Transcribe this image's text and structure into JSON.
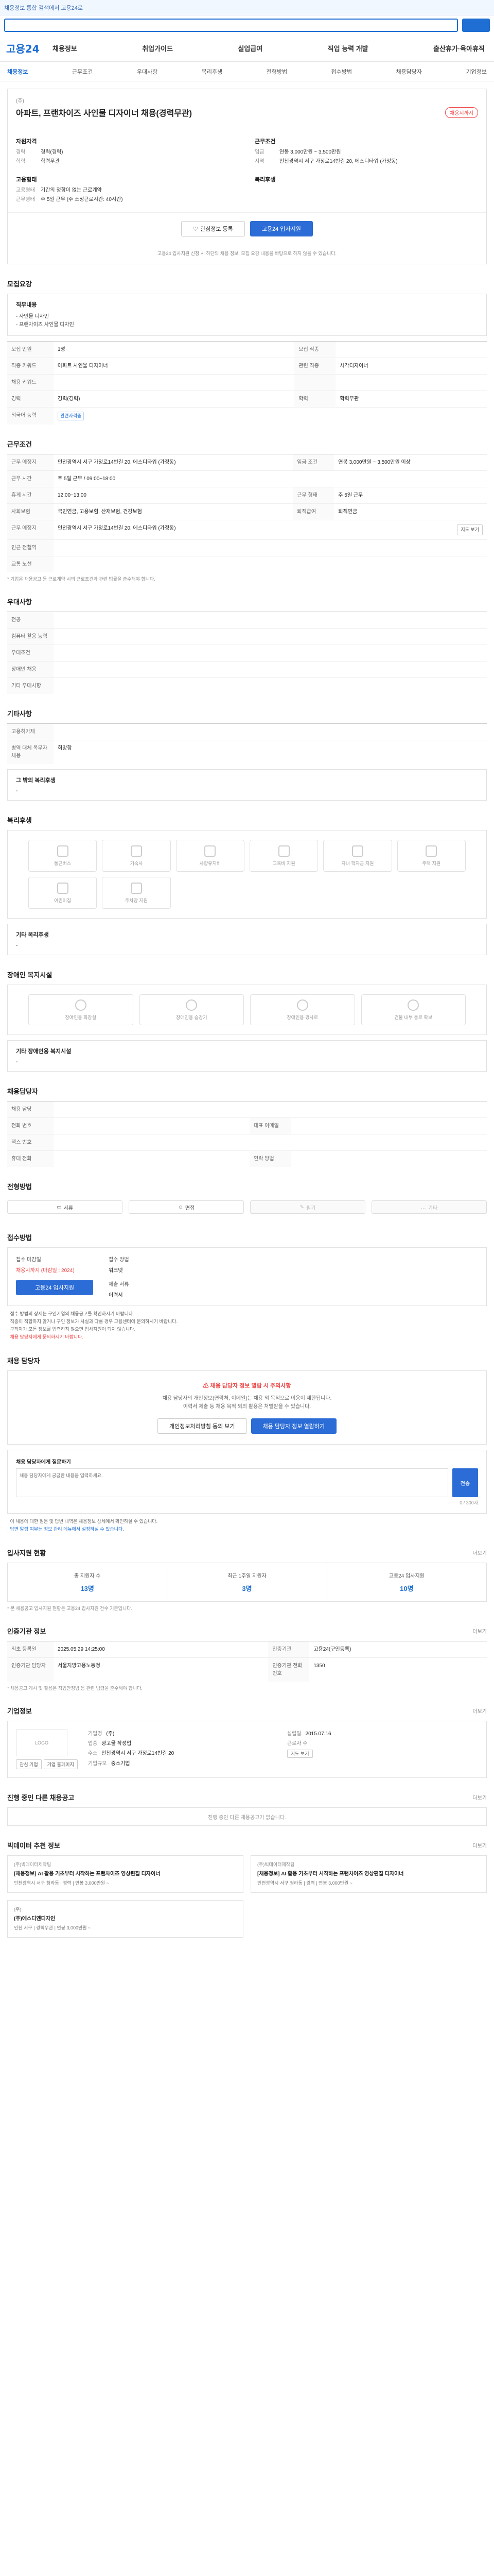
{
  "topbar": {
    "text": "채용정보 통합 검색에서 고용24로"
  },
  "gnb": {
    "logo": "고용24",
    "nav": [
      "채용정보",
      "취업가이드",
      "실업급여",
      "직업 능력 개발",
      "출산휴가·육아휴직"
    ]
  },
  "lnb": [
    "채용정보",
    "근무조건",
    "우대사항",
    "복리후생",
    "전형방법",
    "접수방법",
    "채용담당자",
    "기업정보"
  ],
  "job": {
    "company": "(주)",
    "title": "아파트, 프랜차이즈 사인물 디자이너 채용(경력무관)",
    "badge": "채용시까지",
    "left_head": "자원자격",
    "left_kv": [
      {
        "k": "경력",
        "v": "경력(경력)"
      },
      {
        "k": "학력",
        "v": "학력무관"
      }
    ],
    "right_head": "근무조건",
    "right_kv": [
      {
        "k": "임금",
        "v": "연봉 3,000만원 ~ 3,500만원"
      },
      {
        "k": "지역",
        "v": "인천광역시 서구 가정로14번길 20, 에스디타워 (가정동)"
      }
    ],
    "left2_head": "고용형태",
    "left2_kv": [
      {
        "k": "고용형태",
        "v": "기간의 정함이 없는 근로계약"
      },
      {
        "k": "근무형태",
        "v": "주 5일 근무 (주 소정근로시간: 40시간)"
      }
    ],
    "right2_head": "복리후생",
    "right2_kv": [],
    "btn_scrap": "관심정보 등록",
    "btn_apply": "고용24 입사지원",
    "note": "고용24 입사지원 신청 시 하단의 채용 정보, 모집 요강 내용을 바탕으로 하지 않을 수 있습니다."
  },
  "recruit": {
    "title": "모집요강",
    "work_label": "직무내용",
    "work_lines": [
      "- 사인물 디자인",
      "- 프랜차이즈 사인물 디자인"
    ],
    "rows": [
      {
        "k": "모집 인원",
        "v": "1명",
        "k2": "모집 직종",
        "v2": ""
      },
      {
        "k": "직종 키워드",
        "v": "아파트 사인물 디자이너",
        "k2": "관련 직종",
        "v2": "시각디자이너"
      },
      {
        "k": "채용 키워드",
        "v": "",
        "k2": "",
        "v2": ""
      },
      {
        "k": "경력",
        "v": "경력(경력)",
        "k2": "학력",
        "v2": "학력무관"
      },
      {
        "k": "외국어 능력",
        "v": "관련자격증",
        "k2": "",
        "v2": ""
      }
    ]
  },
  "conditions": {
    "title": "근무조건",
    "rows": [
      {
        "k": "근무 예정지",
        "v": "인천광역시 서구 가정로14번길 20, 에스디타워 (가정동)",
        "k2": "임금 조건",
        "v2": "연봉 3,000만원 ~ 3,500만원 이상"
      },
      {
        "k": "근무 시간",
        "v": "주 5일 근무 / 09:00~18:00",
        "k2": "",
        "v2": ""
      },
      {
        "k": "휴게 시간",
        "v": "12:00~13:00",
        "k2": "근무 형태",
        "v2": "주 5일 근무"
      },
      {
        "k": "사회보험",
        "v": "국민연금, 고용보험, 산재보험, 건강보험",
        "k2": "퇴직급여",
        "v2": "퇴직연금"
      },
      {
        "k": "근무 예정지",
        "v": "인천광역시 서구 가정로14번길 20, 에스디타워 (가정동)",
        "k2": "",
        "v2": ""
      },
      {
        "k": "인근 전철역",
        "v": "",
        "k2": "",
        "v2": ""
      },
      {
        "k": "교통 노선",
        "v": "",
        "k2": "",
        "v2": ""
      }
    ],
    "map_btn": "지도 보기",
    "note": "* 기업은 채용공고 등 근로계약 시의 근로조건과 관련 법률을 준수해야 합니다."
  },
  "prefer": {
    "title": "우대사항",
    "rows": [
      {
        "k": "전공",
        "v": ""
      },
      {
        "k": "컴퓨터 활용 능력",
        "v": ""
      },
      {
        "k": "우대조건",
        "v": ""
      },
      {
        "k": "장애인 채용",
        "v": ""
      },
      {
        "k": "기타 우대사항",
        "v": ""
      }
    ]
  },
  "etc": {
    "title": "기타사항",
    "rows": [
      {
        "k": "고용허가제",
        "v": ""
      },
      {
        "k": "병역 대체 복무자 채용",
        "v": "희망함"
      }
    ],
    "other_label": "그 밖의 복리후생",
    "other_value": "-"
  },
  "welfare": {
    "title": "복리후생",
    "items": [
      "통근버스",
      "기숙사",
      "차량유지비",
      "교육비 지원",
      "자녀 학자금 지원",
      "주택 지원",
      "어린이집",
      "주차장 지원",
      "",
      "",
      "",
      ""
    ],
    "other_label": "기타 복리후생",
    "other_value": "-"
  },
  "disabled": {
    "title": "장애인 복지시설",
    "items": [
      "장애인용 화장실",
      "장애인용 승강기",
      "장애인용 경사로",
      "건물 내부 통로 확보"
    ],
    "other_label": "기타 장애인용 복지시설",
    "other_value": "-"
  },
  "contact_info": {
    "title": "채용담당자",
    "rows": [
      {
        "k": "채용 담당",
        "v": "",
        "k2": "",
        "v2": ""
      },
      {
        "k": "전화 번호",
        "v": "",
        "k2": "대표 이메일",
        "v2": ""
      },
      {
        "k": "팩스 번호",
        "v": "",
        "k2": "",
        "v2": ""
      },
      {
        "k": "휴대 전화",
        "v": "",
        "k2": "연락 방법",
        "v2": ""
      }
    ]
  },
  "selection": {
    "title": "전형방법",
    "methods": [
      "서류",
      "면접",
      "필기",
      "기타"
    ]
  },
  "apply": {
    "title": "접수방법",
    "deadline_label": "접수 마감일",
    "deadline_value": "채용시까지 (마감일 : 2024)",
    "apply_btn": "고용24 입사지원",
    "method_label": "접수 방법",
    "method_value": "워크넷",
    "docs_label": "제출 서류",
    "docs_value": "이력서",
    "bullets": [
      "· 접수 방법의 상세는 구인기업의 채용공고를 확인하시기 바랍니다.",
      "· 직종이 적합하지 않거나 구인 정보가 사실과 다를 경우 고용센터에 문의하시기 바랍니다.",
      "· 구직자가 모든 정보를 입력하지 않으면 입사지원이 되지 않습니다.",
      "· 채용 담당자에게 문의하시기 바랍니다."
    ]
  },
  "manager": {
    "title": "채용 담당자",
    "warn_head": "채용 담당자 정보 열람 시 주의사항",
    "warn_lines": [
      "채용 담당자의 개인정보(연락처, 이메일)는 채용 외 목적으로 이용이 제한됩니다.",
      "이력서 제출 등 채용 목적 외의 활용은 처벌받을 수 있습니다."
    ],
    "btn1": "개인정보처리방침 동의 보기",
    "btn2": "채용 담당자 정보 열람하기",
    "qna_label": "채용 담당자에게 질문하기",
    "qna_placeholder": "채용 담당자에게 궁금한 내용을 입력하세요.",
    "qna_count": "0 / 300자",
    "qna_btn": "전송",
    "qna_notes": [
      "· 이 채용에 대한 질문 및 답변 내역은 채용정보 상세에서 확인하실 수 있습니다.",
      "· 답변 알림 여부는 정보 관리 메뉴에서 설정하실 수 있습니다."
    ]
  },
  "stats": {
    "title": "입사지원 현황",
    "more": "더보기",
    "items": [
      {
        "label": "총 지원자 수",
        "value": "13명"
      },
      {
        "label": "최근 1주일 지원자",
        "value": "3명"
      },
      {
        "label": "고용24 입사지원",
        "value": "10명"
      }
    ],
    "note": "* 본 채용공고 입사지원 현황은 고용24 입사지원 건수 기준입니다."
  },
  "org": {
    "title": "인증기관 정보",
    "more": "더보기",
    "rows": [
      {
        "k": "최초 등록일",
        "v": "2025.05.29 14:25:00",
        "k2": "인증기관",
        "v2": "고용24(구인등록)"
      },
      {
        "k": "인증기관 담당자",
        "v": "서울지방고용노동청",
        "k2": "인증기관 전화번호",
        "v2": "1350"
      }
    ],
    "note": "* 채용공고 게시 및 활용은 직업안정법 등 관련 법령을 준수해야 합니다."
  },
  "company": {
    "title": "기업정보",
    "more": "더보기",
    "logo": "LOGO",
    "btn1": "관심 기업",
    "btn2": "기업 홈페이지",
    "info": [
      {
        "k": "기업명",
        "v": "(주)"
      },
      {
        "k": "설립일",
        "v": "2015.07.16"
      },
      {
        "k": "업종",
        "v": "광고물 작성업"
      },
      {
        "k": "근로자 수",
        "v": ""
      },
      {
        "k": "주소",
        "v": "인천광역시 서구 가정로14번길 20"
      },
      {
        "k": "",
        "v": ""
      },
      {
        "k": "기업규모",
        "v": "중소기업"
      },
      {
        "k": "",
        "v": ""
      }
    ],
    "map_btn": "지도 보기"
  },
  "others": {
    "title": "진행 중인 다른 채용공고",
    "more": "더보기",
    "empty": "진행 중인 다른 채용공고가 없습니다."
  },
  "recommend": {
    "title": "빅데이터 추천 정보",
    "more": "더보기",
    "cards": [
      {
        "co": "(주)빅데이터제작팀",
        "title": "[채용정보] AI 활용 기초부터 시작하는 프랜차이즈 영상편집 디자이너",
        "meta": "인천광역시 서구 청라동 | 경력 | 연봉 3,000만원 ~"
      },
      {
        "co": "(주)빅데이터제작팀",
        "title": "[채용정보] AI 활용 기초부터 시작하는 프랜차이즈 영상편집 디자이너",
        "meta": "인천광역시 서구 청라동 | 경력 | 연봉 3,000만원 ~"
      },
      {
        "co": "(주)",
        "title": "(주)에스디엔디자인",
        "meta": "인천 서구 | 경력무관 | 연봉 3,000만원 ~"
      }
    ]
  },
  "colors": {
    "accent": "#1e6ed3",
    "warn": "#e44444"
  }
}
